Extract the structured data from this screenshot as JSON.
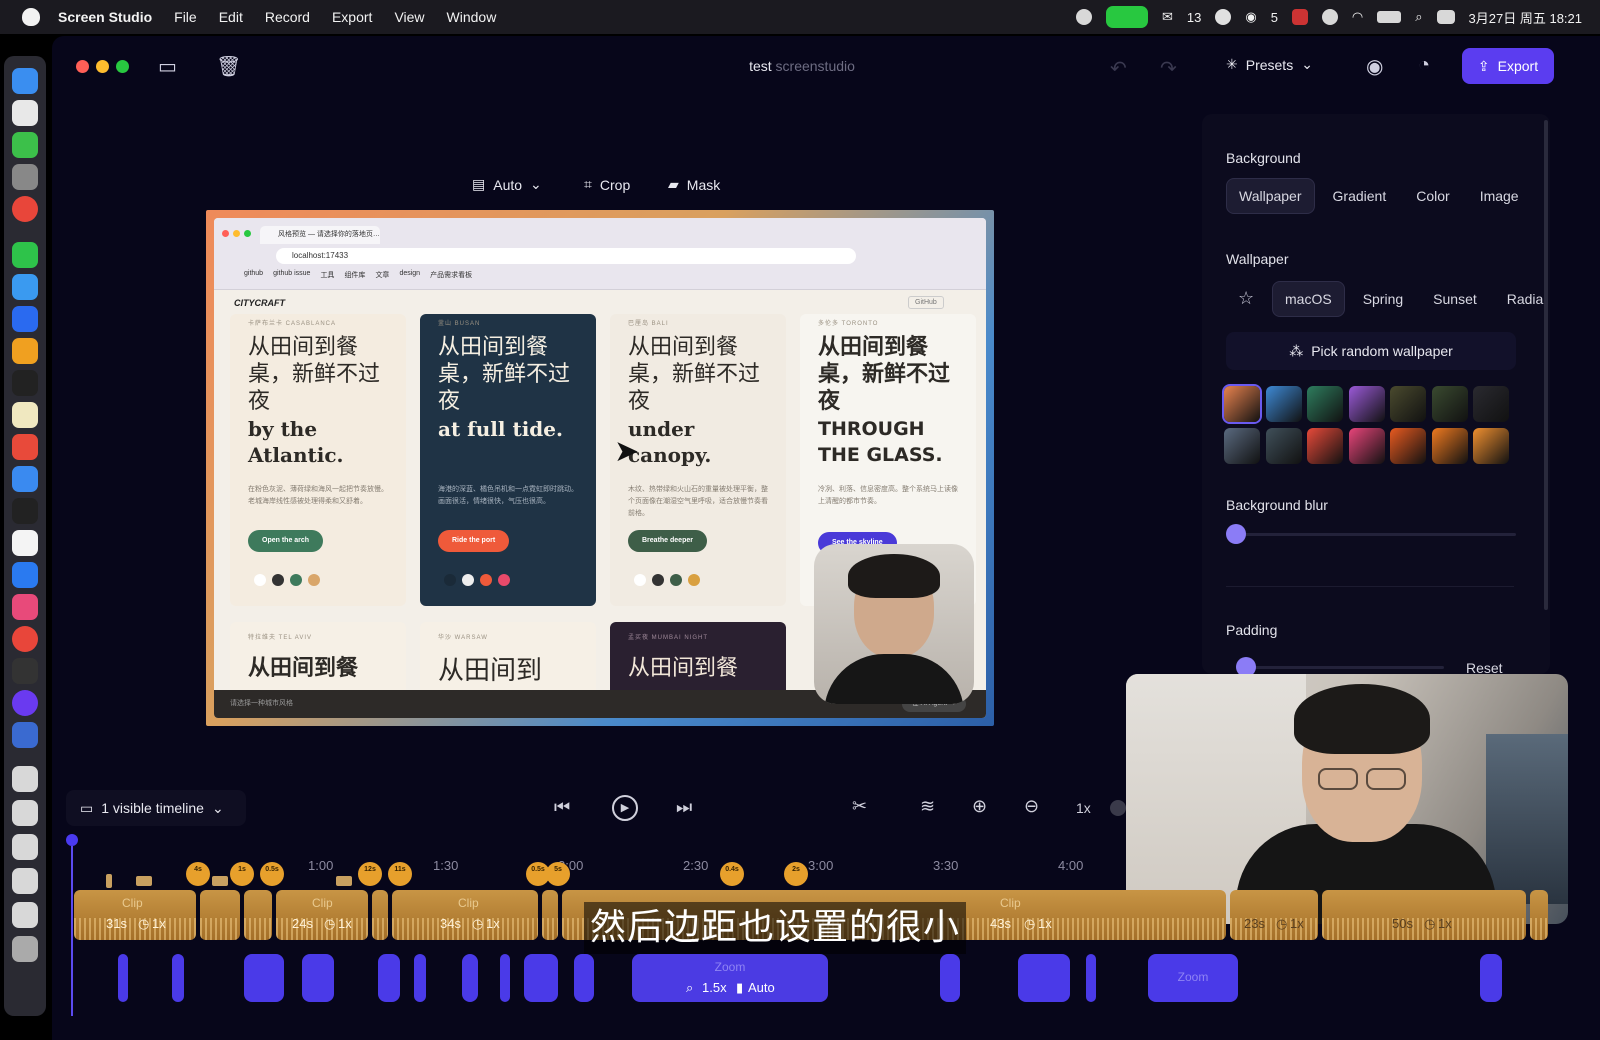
{
  "menubar": {
    "app_name": "Screen Studio",
    "items": [
      "File",
      "Edit",
      "Record",
      "Export",
      "View",
      "Window"
    ],
    "status_badges": {
      "mail_count": "13",
      "wechat_count": "5"
    },
    "clock": "3月27日 周五 18:21"
  },
  "window": {
    "title_main": "test",
    "title_sub": "screenstudio",
    "presets_label": "Presets",
    "export_label": "Export"
  },
  "preview_toolbar": {
    "auto_label": "Auto",
    "crop_label": "Crop",
    "mask_label": "Mask"
  },
  "preview": {
    "url": "localhost:17433",
    "tab_title": "风格预览 — 请选择你的落地页…",
    "bookmarks": [
      "github",
      "github issue",
      "工具",
      "组件库",
      "文章",
      "design",
      "产品需求看板"
    ],
    "brand": "CITYCRAFT",
    "github_label": "GitHub",
    "cards": [
      {
        "loc": "卡萨布兰卡 CASABLANCA",
        "headline": "从田间到餐桌，新鲜不过夜",
        "tagline": "by the Atlantic.",
        "body": "在粉色灰泥、薄荷绿和海风一起把节奏放慢。老城海岸线性感被处理得柔和又舒着。",
        "cta": "Open the arch",
        "cta_color": "#3e7a5c"
      },
      {
        "loc": "釜山 BUSAN",
        "headline": "从田间到餐桌，新鲜不过夜",
        "tagline": "at full tide.",
        "body": "海港的深蓝、橘色吊机和一点霓虹即时跳动。画面很活，情绪很快，气压也很高。",
        "cta": "Ride the port",
        "cta_color": "#ef5a3a"
      },
      {
        "loc": "巴厘岛 BALI",
        "headline": "从田间到餐桌，新鲜不过夜",
        "tagline": "under canopy.",
        "body": "木纹、热带绿和火山石的重量被处理平衡，整个页面像在潮湿空气里呼吸，适合放慢节奏看前格。",
        "cta": "Breathe deeper",
        "cta_color": "#3e5e48"
      },
      {
        "loc": "多伦多 TORONTO",
        "headline": "从田间到餐桌，新鲜不过夜",
        "tagline": "THROUGH THE GLASS.",
        "body": "冷冽、利落、信息密度高。整个系统马上读像上清醒的都市节奏。",
        "cta": "See the skyline",
        "cta_color": "#4a3ad8"
      }
    ],
    "bottom_cards": [
      {
        "loc": "特拉维夫 TEL AVIV",
        "headline": "从田间到餐"
      },
      {
        "loc": "华沙 WARSAW",
        "headline": "从田间到"
      },
      {
        "loc": "孟买夜 MUMBAI NIGHT",
        "headline": "从田间到餐"
      }
    ],
    "footer_text": "请选择一种城市风格",
    "footer_btn": "在 AI Agent →"
  },
  "panel": {
    "background_label": "Background",
    "bg_tabs": [
      "Wallpaper",
      "Gradient",
      "Color",
      "Image"
    ],
    "wallpaper_label": "Wallpaper",
    "wp_tabs": [
      "macOS",
      "Spring",
      "Sunset",
      "Radia"
    ],
    "pick_random": "Pick random wallpaper",
    "blur_label": "Background blur",
    "blur_value": 0,
    "padding_label": "Padding",
    "padding_value": 0.05,
    "reset_label": "Reset",
    "swatches": [
      "#e9834f",
      "#3e8ad6",
      "#2e7d5e",
      "#9b5ad8",
      "#4a4a2e",
      "#3a4a30",
      "#2a2a30",
      "#5a6a80",
      "#40505a",
      "#e84a3a",
      "#e8457a",
      "#e85a20",
      "#ef7a20",
      "#f09030"
    ]
  },
  "timeline": {
    "visible_label": "1 visible timeline",
    "speed_label": "1x",
    "ruler": [
      "1:00",
      "1:30",
      "2:00",
      "2:30",
      "3:00",
      "3:30",
      "4:00"
    ],
    "clips": [
      {
        "label": "Clip",
        "duration": "31s",
        "speed": "1x"
      },
      {
        "label": "Clip",
        "duration": "24s",
        "speed": "1x"
      },
      {
        "label": "Clip",
        "duration": "34s",
        "speed": "1x"
      },
      {
        "label": "Clip",
        "duration": "43s",
        "speed": "1x"
      },
      {
        "label": "",
        "duration": "23s",
        "speed": "1x"
      },
      {
        "label": "",
        "duration": "50s",
        "speed": "1x"
      }
    ],
    "markers": [
      "4s",
      "1s",
      "0.5s",
      "12s",
      "11s",
      "0.5s",
      "5s",
      "0.4s",
      "2s"
    ],
    "zoom_main": {
      "label": "Zoom",
      "factor": "1.5x",
      "mode": "Auto"
    },
    "zoom_secondary": "Zoom",
    "subtitle": "然后边距也设置的很小"
  },
  "colors": {
    "accent": "#5b3df0",
    "clip": "#c08a3e",
    "zoom": "#4a3ae8",
    "marker": "#e7a02c"
  }
}
